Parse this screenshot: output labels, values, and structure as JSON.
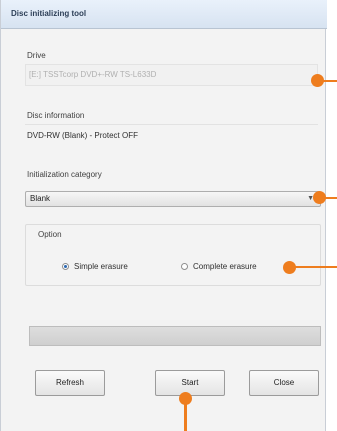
{
  "window": {
    "title": "Disc initializing tool"
  },
  "drive": {
    "label": "Drive",
    "value": "[E:] TSSTcorp DVD+-RW TS-L633D"
  },
  "disc_information": {
    "label": "Disc information",
    "value": "DVD-RW (Blank) - Protect OFF"
  },
  "initialization_category": {
    "label": "Initialization category",
    "selected": "Blank",
    "arrow_icon": "chevron-down-icon"
  },
  "option": {
    "label": "Option",
    "choices": [
      {
        "label": "Simple erasure",
        "selected": true
      },
      {
        "label": "Complete erasure",
        "selected": false
      }
    ]
  },
  "progress": {
    "value": 0
  },
  "buttons": {
    "refresh": "Refresh",
    "start": "Start",
    "close": "Close"
  },
  "colors": {
    "callout": "#ee7d1e",
    "radio_selected": "#2a67b1"
  }
}
